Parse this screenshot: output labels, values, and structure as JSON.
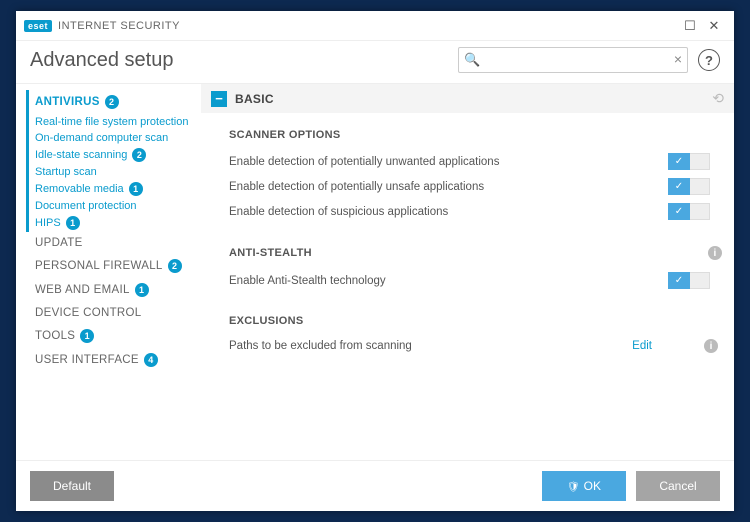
{
  "titlebar": {
    "brand_logo": "eset",
    "brand_text": "INTERNET SECURITY"
  },
  "header": {
    "title": "Advanced setup",
    "search_placeholder": ""
  },
  "sidebar": {
    "categories": [
      {
        "label": "ANTIVIRUS",
        "badge": "2",
        "active": true,
        "subs": [
          {
            "label": "Real-time file system protection"
          },
          {
            "label": "On-demand computer scan"
          },
          {
            "label": "Idle-state scanning",
            "badge": "2"
          },
          {
            "label": "Startup scan"
          },
          {
            "label": "Removable media",
            "badge": "1"
          },
          {
            "label": "Document protection"
          },
          {
            "label": "HIPS",
            "badge": "1"
          }
        ]
      },
      {
        "label": "UPDATE"
      },
      {
        "label": "PERSONAL FIREWALL",
        "badge": "2"
      },
      {
        "label": "WEB AND EMAIL",
        "badge": "1"
      },
      {
        "label": "DEVICE CONTROL"
      },
      {
        "label": "TOOLS",
        "badge": "1"
      },
      {
        "label": "USER INTERFACE",
        "badge": "4"
      }
    ]
  },
  "content": {
    "section_title": "BASIC",
    "groups": [
      {
        "title": "SCANNER OPTIONS",
        "rows": [
          {
            "label": "Enable detection of potentially unwanted applications",
            "on": true
          },
          {
            "label": "Enable detection of potentially unsafe applications",
            "on": true
          },
          {
            "label": "Enable detection of suspicious applications",
            "on": true
          }
        ]
      },
      {
        "title": "ANTI-STEALTH",
        "info": true,
        "rows": [
          {
            "label": "Enable Anti-Stealth technology",
            "on": true
          }
        ]
      },
      {
        "title": "EXCLUSIONS",
        "rows": [
          {
            "label": "Paths to be excluded from scanning",
            "link": "Edit",
            "info": true
          }
        ]
      }
    ]
  },
  "footer": {
    "default": "Default",
    "ok": "OK",
    "cancel": "Cancel"
  }
}
